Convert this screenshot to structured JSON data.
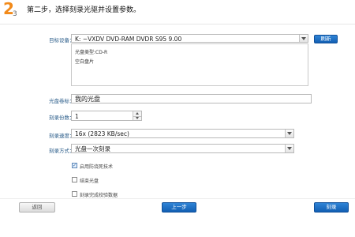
{
  "header": {
    "step_big": "2",
    "step_small": "3",
    "title": "第二步，选择刻录光驱并设置参数。"
  },
  "target_device": {
    "label": "目标设备：",
    "value": "K:  ~VXDV    DVD-RAM DVDR S95 9.00",
    "refresh_label": "刷新",
    "disc_type": "光盘类型:CD-R",
    "disc_status": "空白盘片"
  },
  "volume_label": {
    "label": "光盘卷标：",
    "value": "我的光盘"
  },
  "copies": {
    "label": "刻录份数：",
    "value": "1"
  },
  "speed": {
    "label": "刻录速度：",
    "value": "16x (2823 KB/sec)"
  },
  "mode": {
    "label": "刻录方式：",
    "value": "光盘一次刻录"
  },
  "options": [
    {
      "label": "启用防烧死技术",
      "checked": true
    },
    {
      "label": "结束光盘",
      "checked": false
    },
    {
      "label": "刻录完成校验数据",
      "checked": false
    }
  ],
  "footer": {
    "back_label": "返回",
    "prev_label": "上一步",
    "burn_label": "刻录"
  }
}
